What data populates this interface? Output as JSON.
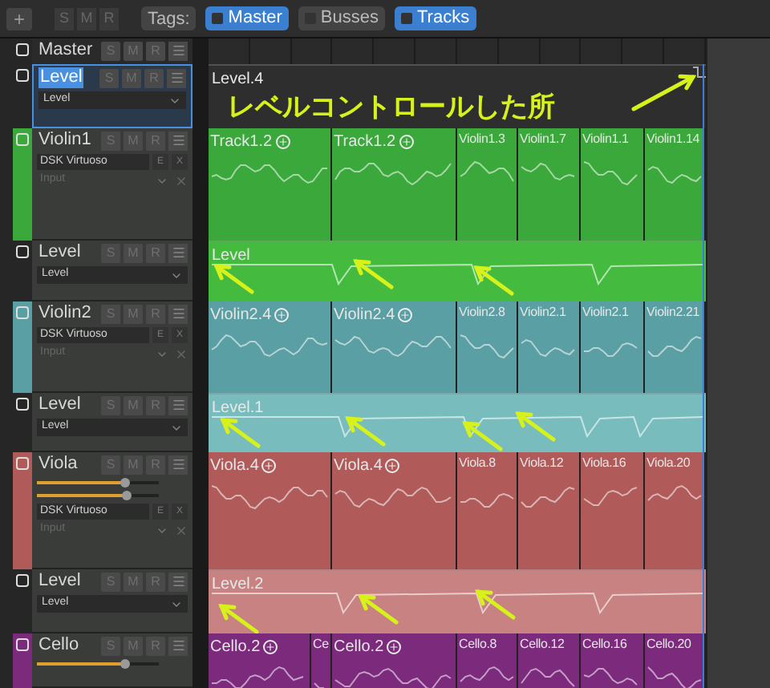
{
  "toolbar": {
    "add_button": "+",
    "buttons": [
      "S",
      "M",
      "R"
    ],
    "tags_label": "Tags:",
    "tags": [
      {
        "label": "Master",
        "selected": true
      },
      {
        "label": "Busses",
        "selected": false
      },
      {
        "label": "Tracks",
        "selected": true
      }
    ]
  },
  "tracks": [
    {
      "kind": "master",
      "name": "Master",
      "selected": false,
      "buttons": [
        "S",
        "M",
        "R"
      ]
    },
    {
      "kind": "automation",
      "name": "Level",
      "selected": true,
      "color": "#2e2e2e",
      "buttons": [
        "S",
        "M",
        "R"
      ],
      "parameter": "Level",
      "region": "Level.4",
      "annotation": "レベルコントロールした所"
    },
    {
      "kind": "instrument",
      "name": "Violin1",
      "selected": false,
      "color": "#3aa83a",
      "buttons": [
        "S",
        "M",
        "R"
      ],
      "instrument": "DSK Virtuoso",
      "instrument_buttons": [
        "E",
        "X"
      ],
      "input": "Input",
      "regions": [
        {
          "label": "Track1.2",
          "plus": true
        },
        {
          "label": "Track1.2",
          "plus": true
        },
        {
          "label": "Violin1.3",
          "plus": false
        },
        {
          "label": "Violin1.7",
          "plus": false
        },
        {
          "label": "Violin1.1",
          "plus": false
        },
        {
          "label": "Violin1.14",
          "plus": false
        }
      ]
    },
    {
      "kind": "automation",
      "name": "Level",
      "selected": false,
      "color": "#44bb3e",
      "buttons": [
        "S",
        "M",
        "R"
      ],
      "parameter": "Level",
      "region": "Level"
    },
    {
      "kind": "instrument",
      "name": "Violin2",
      "selected": false,
      "color": "#5a9fa3",
      "buttons": [
        "S",
        "M",
        "R"
      ],
      "instrument": "DSK Virtuoso",
      "instrument_buttons": [
        "E",
        "X"
      ],
      "input": "Input",
      "regions": [
        {
          "label": "Violin2.4",
          "plus": true
        },
        {
          "label": "Violin2.4",
          "plus": true
        },
        {
          "label": "Violin2.8",
          "plus": false
        },
        {
          "label": "Violin2.1",
          "plus": false
        },
        {
          "label": "Violin2.1",
          "plus": false
        },
        {
          "label": "Violin2.21",
          "plus": false
        }
      ]
    },
    {
      "kind": "automation",
      "name": "Level",
      "selected": false,
      "color": "#78bcbd",
      "buttons": [
        "S",
        "M",
        "R"
      ],
      "parameter": "Level",
      "region": "Level.1"
    },
    {
      "kind": "instrument",
      "name": "Viola",
      "selected": false,
      "color": "#b05a5a",
      "buttons": [
        "S",
        "M",
        "R"
      ],
      "sliders": [
        {
          "level": 0.72
        },
        {
          "level": 0.74
        }
      ],
      "instrument": "DSK Virtuoso",
      "instrument_buttons": [
        "E",
        "X"
      ],
      "input": "Input",
      "regions": [
        {
          "label": "Viola.4",
          "plus": true
        },
        {
          "label": "Viola.4",
          "plus": true
        },
        {
          "label": "Viola.8",
          "plus": false
        },
        {
          "label": "Viola.12",
          "plus": false
        },
        {
          "label": "Viola.16",
          "plus": false
        },
        {
          "label": "Viola.20",
          "plus": false
        }
      ]
    },
    {
      "kind": "automation",
      "name": "Level",
      "selected": false,
      "color": "#c88282",
      "buttons": [
        "S",
        "M",
        "R"
      ],
      "parameter": "Level",
      "region": "Level.2"
    },
    {
      "kind": "instrument",
      "name": "Cello",
      "selected": false,
      "color": "#7c2a7c",
      "buttons": [
        "S",
        "M",
        "R"
      ],
      "sliders": [
        {
          "level": 0.72
        }
      ],
      "regions": [
        {
          "label": "Cello.2",
          "plus": true
        },
        {
          "label": "Ce",
          "plus": false
        },
        {
          "label": "Cello.2",
          "plus": true
        },
        {
          "label": "Cello.8",
          "plus": false
        },
        {
          "label": "Cello.12",
          "plus": false
        },
        {
          "label": "Cello.16",
          "plus": false
        },
        {
          "label": "Cello.20",
          "plus": false
        }
      ]
    }
  ]
}
